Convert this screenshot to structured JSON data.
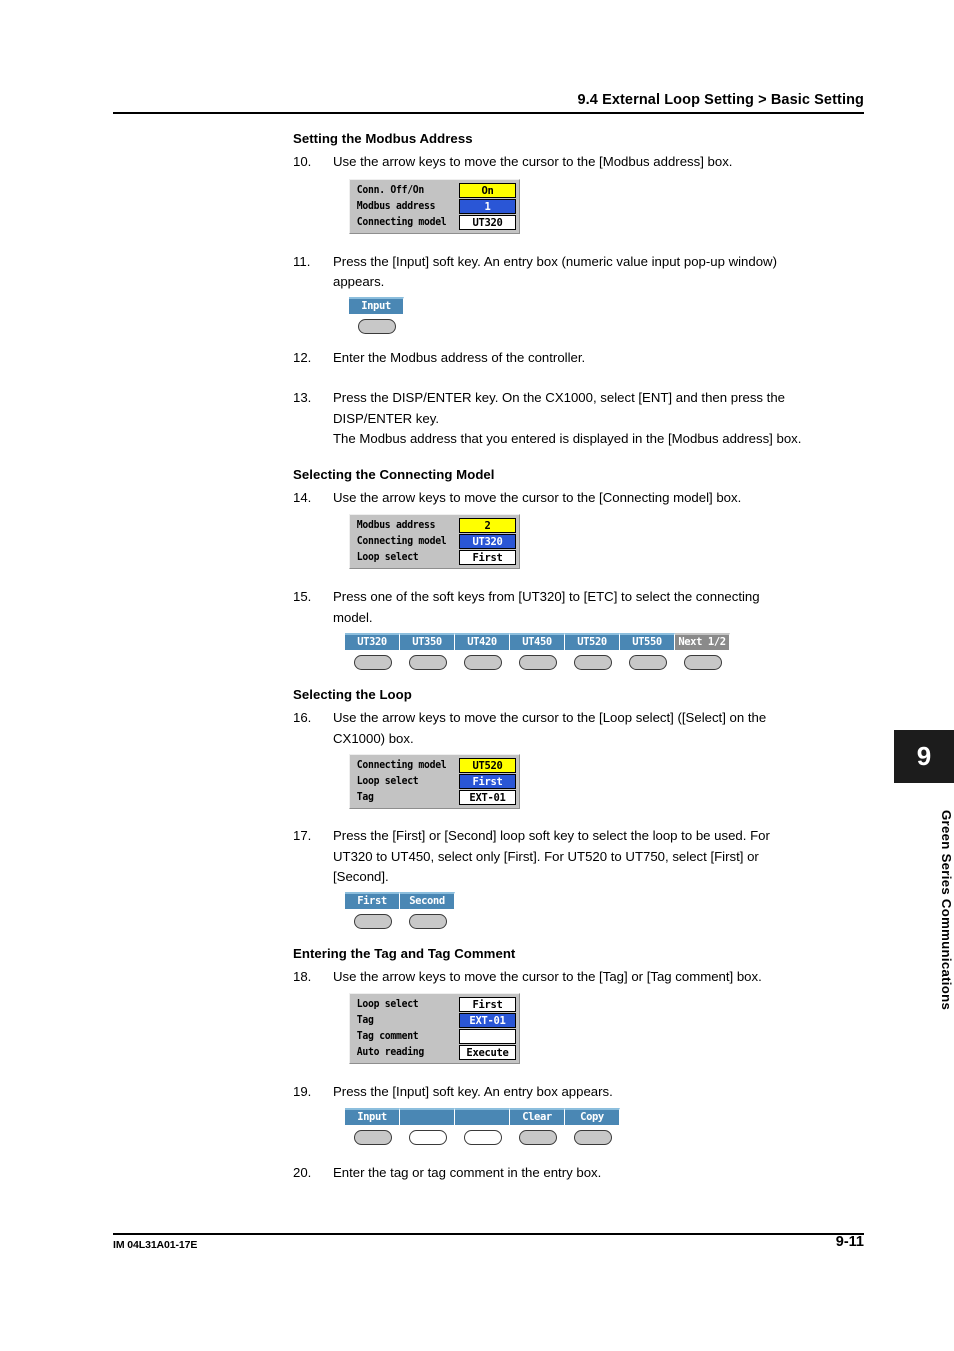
{
  "header": {
    "title": "9.4  External Loop Setting > Basic Setting"
  },
  "footer": {
    "doc_id": "IM 04L31A01-17E",
    "page_number": "9-11"
  },
  "chapter_tab": {
    "number": "9",
    "label": "Green Series Communications"
  },
  "sections": {
    "modbus": {
      "heading": "Setting the Modbus Address",
      "step10": {
        "num": "10.",
        "text": "Use the arrow keys to move the cursor to the [Modbus address] box."
      },
      "panel10": {
        "rows": [
          {
            "label": "Conn. Off/On",
            "value": "On",
            "state": "hi"
          },
          {
            "label": "Modbus address",
            "value": "1",
            "state": "sel"
          },
          {
            "label": "Connecting model",
            "value": "UT320",
            "state": "none"
          }
        ]
      },
      "step11": {
        "num": "11.",
        "line1": "Press the [Input] soft key.  An entry box (numeric value input pop-up window)",
        "line2": "appears."
      },
      "softkeys11": [
        {
          "label": "Input",
          "style": "blue",
          "key": "filled"
        }
      ],
      "step12": {
        "num": "12.",
        "text": "Enter the Modbus address of the controller."
      },
      "step13": {
        "num": "13.",
        "line1": "Press the DISP/ENTER key.  On the CX1000, select [ENT] and then press the",
        "line2": "DISP/ENTER key.",
        "line3": "The Modbus address that you entered is displayed in the [Modbus address] box."
      }
    },
    "connecting_model": {
      "heading": "Selecting the Connecting Model",
      "step14": {
        "num": "14.",
        "text": "Use the arrow keys to move the cursor to the [Connecting model] box."
      },
      "panel14": {
        "rows": [
          {
            "label": "Modbus address",
            "value": "2",
            "state": "hi"
          },
          {
            "label": "Connecting model",
            "value": "UT320",
            "state": "sel"
          },
          {
            "label": "Loop select",
            "value": "First",
            "state": "none"
          }
        ]
      },
      "step15": {
        "num": "15.",
        "line1": "Press one of the soft keys from [UT320] to [ETC] to select the connecting",
        "line2": "model."
      },
      "softkeys15": [
        {
          "label": "UT320",
          "style": "blue",
          "key": "filled"
        },
        {
          "label": "UT350",
          "style": "blue",
          "key": "filled"
        },
        {
          "label": "UT420",
          "style": "blue",
          "key": "filled"
        },
        {
          "label": "UT450",
          "style": "blue",
          "key": "filled"
        },
        {
          "label": "UT520",
          "style": "blue",
          "key": "filled"
        },
        {
          "label": "UT550",
          "style": "blue",
          "key": "filled"
        },
        {
          "label": "Next 1/2",
          "style": "gray",
          "key": "filled"
        }
      ]
    },
    "loop": {
      "heading": "Selecting the Loop",
      "step16": {
        "num": "16.",
        "line1": "Use the arrow keys to move the cursor to the [Loop select] ([Select] on the",
        "line2": "CX1000) box."
      },
      "panel16": {
        "rows": [
          {
            "label": "Connecting model",
            "value": "UT520",
            "state": "hi"
          },
          {
            "label": "Loop select",
            "value": "First",
            "state": "sel"
          },
          {
            "label": "Tag",
            "value": "EXT-01",
            "state": "none"
          }
        ]
      },
      "step17": {
        "num": "17.",
        "line1": "Press the [First] or [Second] loop soft key to select the loop to be used.  For",
        "line2": "UT320 to UT450, select only [First].  For UT520 to UT750, select [First] or",
        "line3": "[Second]."
      },
      "softkeys17": [
        {
          "label": "First",
          "style": "blue",
          "key": "filled"
        },
        {
          "label": "Second",
          "style": "blue",
          "key": "filled"
        }
      ]
    },
    "tag": {
      "heading": "Entering the Tag and Tag Comment",
      "step18": {
        "num": "18.",
        "text": "Use the arrow keys to move the cursor to the [Tag] or [Tag comment] box."
      },
      "panel18": {
        "rows": [
          {
            "label": "Loop select",
            "value": "First",
            "state": "none"
          },
          {
            "label": "Tag",
            "value": "EXT-01",
            "state": "sel"
          },
          {
            "label": "Tag comment",
            "value": "",
            "state": "none"
          },
          {
            "label": "Auto reading",
            "value": "Execute",
            "state": "none"
          }
        ]
      },
      "step19": {
        "num": "19.",
        "text": "Press the [Input] soft key.  An entry box appears."
      },
      "softkeys19": [
        {
          "label": "Input",
          "style": "blue",
          "key": "filled"
        },
        {
          "label": "",
          "style": "blue",
          "key": "empty"
        },
        {
          "label": "",
          "style": "blue",
          "key": "empty"
        },
        {
          "label": "Clear",
          "style": "blue",
          "key": "filled"
        },
        {
          "label": "Copy",
          "style": "blue",
          "key": "filled"
        }
      ],
      "step20": {
        "num": "20.",
        "text": "Enter the tag or tag comment in the entry box."
      }
    }
  }
}
